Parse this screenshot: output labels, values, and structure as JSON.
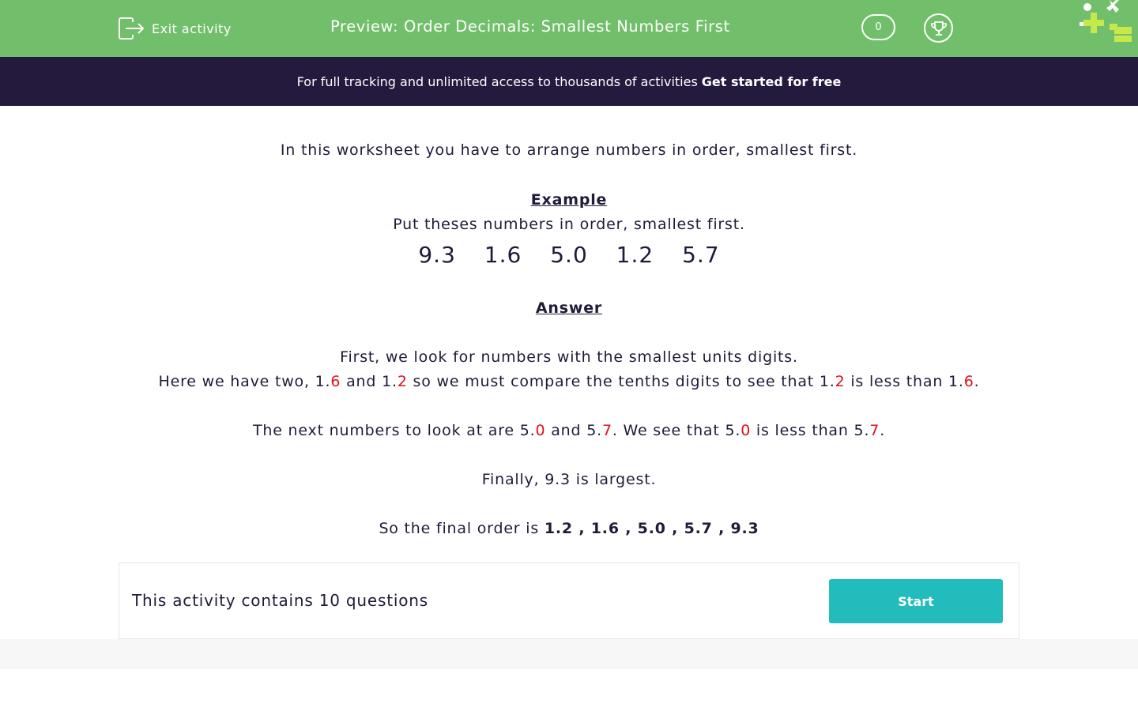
{
  "header": {
    "exit_label": "Exit activity",
    "title": "Preview: Order Decimals: Smallest Numbers First",
    "score": "0",
    "bg_color": "#72bf6b"
  },
  "banner": {
    "text": "For full tracking and unlimited access to thousands of activities",
    "cta": "Get started for free",
    "bg_color": "#241a3d"
  },
  "content": {
    "intro": "In this worksheet you have to arrange numbers in order, smallest first.",
    "example_heading": "Example",
    "example_prompt": "Put theses numbers in order, smallest first.",
    "example_numbers": [
      "9.3",
      "1.6",
      "5.0",
      "1.2",
      "5.7"
    ],
    "answer_heading": "Answer",
    "line1": "First, we look for numbers with the smallest units digits.",
    "line2": {
      "p1": "Here we have two, 1.",
      "r1": "6",
      "p2": " and 1.",
      "r2": "2",
      "p3": " so we must compare the tenths digits to see that 1.",
      "r3": "2",
      "p4": " is less than 1.",
      "r4": "6",
      "p5": "."
    },
    "line3": {
      "p1": "The next numbers to look at are 5.",
      "r1": "0",
      "p2": " and 5.",
      "r2": "7",
      "p3": ".  We see that 5.",
      "r3": "0",
      "p4": " is less than 5.",
      "r4": "7",
      "p5": "."
    },
    "line4": "Finally, 9.3 is largest.",
    "final_prefix": "So the final order is ",
    "final_order": "1.2 , 1.6 , 5.0 , 5.7 , 9.3",
    "highlight_color": "#e0101b"
  },
  "activity": {
    "count_text": "This activity contains 10 questions",
    "start_label": "Start",
    "button_color": "#22bcbc"
  }
}
